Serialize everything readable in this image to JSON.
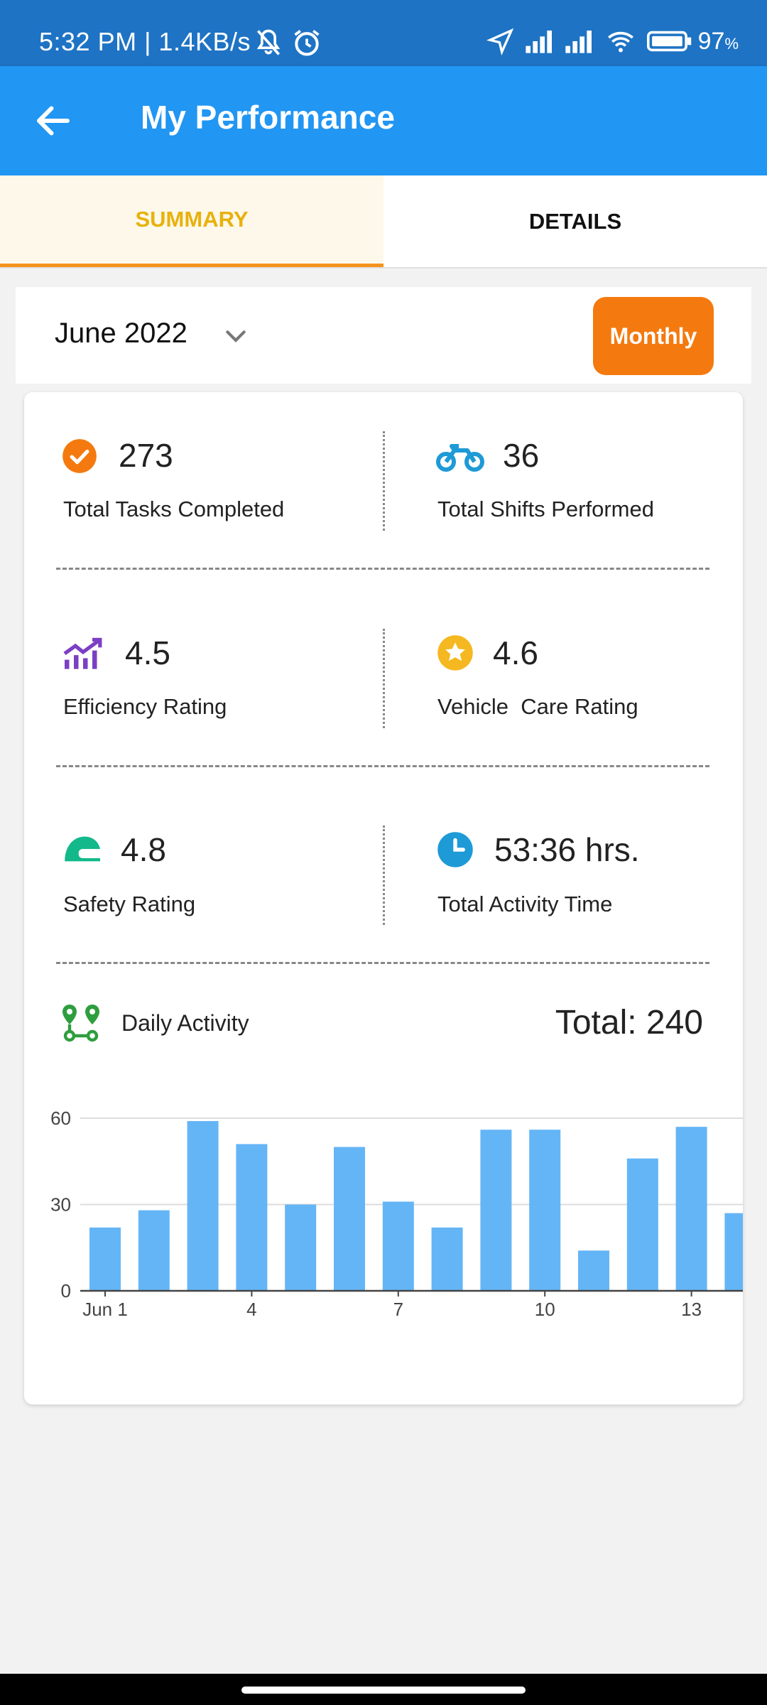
{
  "status_bar": {
    "time": "5:32 PM | 1.4KB/s",
    "battery": "97",
    "battery_unit": "%"
  },
  "app_bar": {
    "title": "My Performance",
    "back_icon": "arrow-back-icon"
  },
  "tabs": [
    {
      "label": "SUMMARY",
      "active": true
    },
    {
      "label": "DETAILS",
      "active": false
    }
  ],
  "period": {
    "month": "June 2022",
    "mode_button": "Monthly"
  },
  "stats": [
    {
      "value": "273",
      "label": "Total Tasks Completed",
      "icon": "check-circle-icon",
      "color": "#f47a0f"
    },
    {
      "value": "36",
      "label": "Total Shifts Performed",
      "icon": "bike-icon",
      "color": "#1e9ad6"
    },
    {
      "value": "4.5",
      "label": "Efficiency Rating",
      "icon": "trending-up-icon",
      "color": "#7b3fc4"
    },
    {
      "value": "4.6",
      "label": "Vehicle  Care Rating",
      "icon": "star-circle-icon",
      "color": "#f5b820"
    },
    {
      "value": "4.8",
      "label": "Safety Rating",
      "icon": "helmet-icon",
      "color": "#13b98a"
    },
    {
      "value": "53:36 hrs.",
      "label": "Total Activity Time",
      "icon": "clock-icon",
      "color": "#1e9ad6"
    }
  ],
  "daily_activity": {
    "title": "Daily Activity",
    "total": "Total: 240",
    "icon": "route-pins-icon"
  },
  "chart_data": {
    "type": "bar",
    "x": [
      1,
      2,
      3,
      4,
      5,
      6,
      7,
      8,
      9,
      10,
      11,
      12,
      13,
      14
    ],
    "values": [
      22,
      28,
      59,
      51,
      30,
      50,
      31,
      22,
      56,
      56,
      14,
      46,
      57,
      27
    ],
    "x_tick_labels": [
      "Jun 1",
      "4",
      "7",
      "10",
      "13"
    ],
    "x_tick_positions": [
      1,
      4,
      7,
      10,
      13
    ],
    "y_ticks": [
      0,
      30,
      60
    ],
    "ylim": [
      0,
      60
    ],
    "bar_color": "#64b5f6",
    "grid": true
  }
}
